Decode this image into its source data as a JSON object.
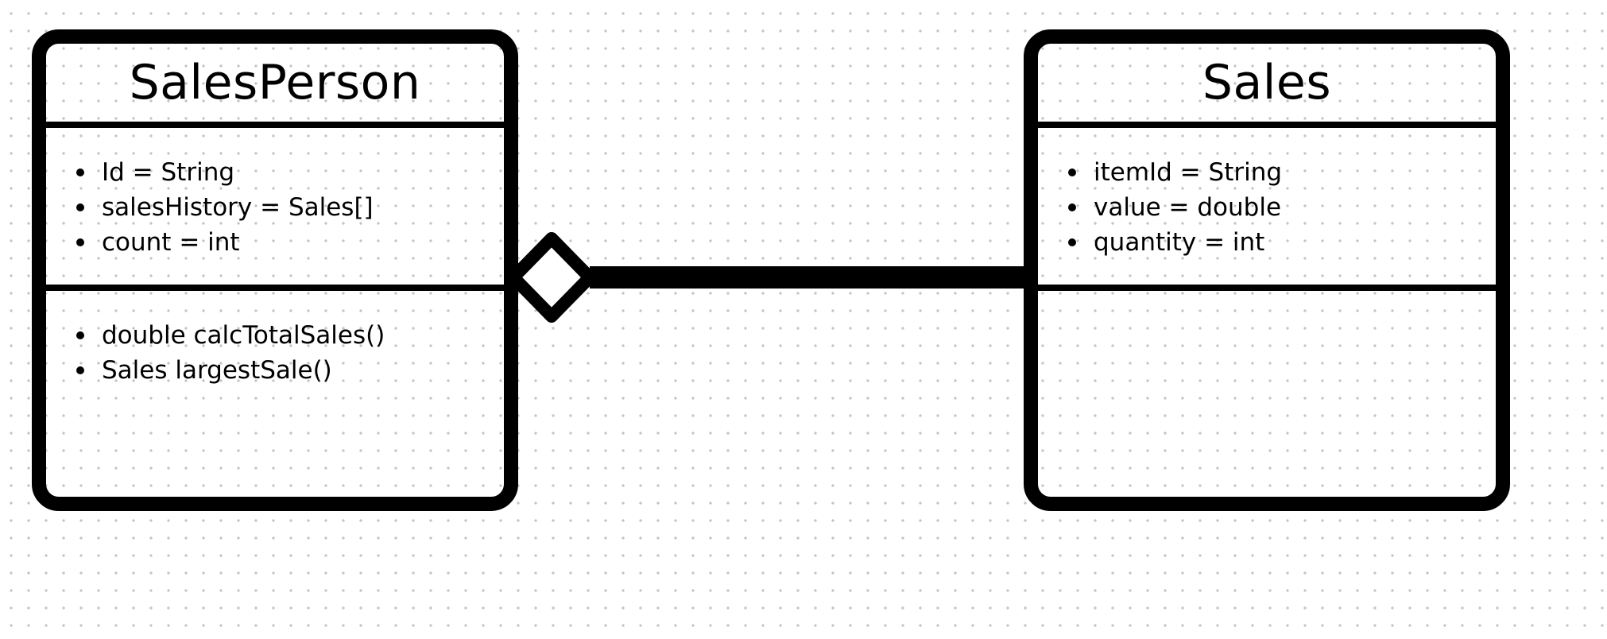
{
  "diagram": {
    "classes": [
      {
        "name": "SalesPerson",
        "attributes": [
          "Id = String",
          "salesHistory = Sales[]",
          "count = int"
        ],
        "methods": [
          "double calcTotalSales()",
          "Sales largestSale()"
        ]
      },
      {
        "name": "Sales",
        "attributes": [
          "itemId = String",
          "value = double",
          "quantity = int"
        ],
        "methods": []
      }
    ],
    "relationship": {
      "type": "aggregation",
      "whole": "SalesPerson",
      "part": "Sales"
    }
  }
}
